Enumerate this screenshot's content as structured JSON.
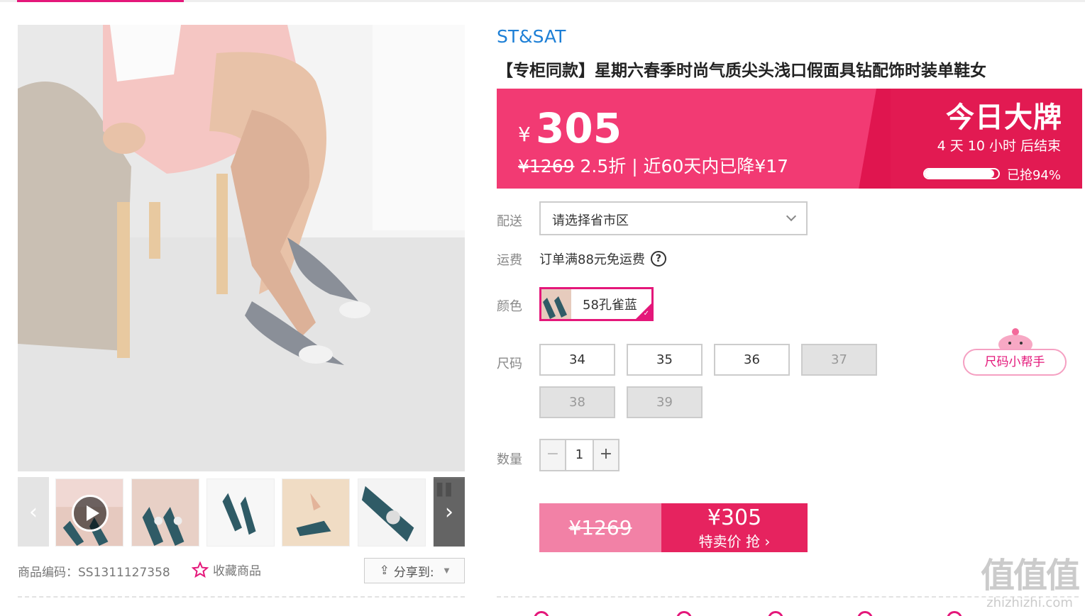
{
  "brand": "ST&SAT",
  "title": "【专柜同款】星期六春季时尚气质尖头浅口假面具钻配饰时装单鞋女",
  "promo": {
    "currency": "¥",
    "price": "305",
    "original_price": "¥1269",
    "discount_info": "2.5折 | 近60天内已降¥17",
    "badge": "今日大牌",
    "countdown": "4 天 10 小时 后结束",
    "grabbed_label": "已抢94%",
    "grabbed_fraction": 0.94
  },
  "delivery": {
    "label": "配送",
    "placeholder": "请选择省市区"
  },
  "shipping": {
    "label": "运费",
    "text": "订单满88元免运费",
    "help": "?"
  },
  "color": {
    "label": "颜色",
    "selected": "58孔雀蓝"
  },
  "size": {
    "label": "尺码",
    "options": [
      {
        "value": "34",
        "available": true
      },
      {
        "value": "35",
        "available": true
      },
      {
        "value": "36",
        "available": true
      },
      {
        "value": "37",
        "available": false
      },
      {
        "value": "38",
        "available": false
      },
      {
        "value": "39",
        "available": false
      }
    ],
    "helper": "尺码小帮手"
  },
  "quantity": {
    "label": "数量",
    "value": "1",
    "minus": "−",
    "plus": "+"
  },
  "buy": {
    "original_price": "¥1269",
    "price": "¥305",
    "label": "特卖价 抢 ›"
  },
  "meta": {
    "sku": "商品编码：SS1311127358",
    "favorite": "收藏商品",
    "share": "分享到:"
  },
  "watermark": {
    "big": "值值值",
    "small": "zhizhizhi.com"
  },
  "colors": {
    "accent": "#e4177a",
    "promo": "#f23a73",
    "brand_link": "#1d7fd6"
  }
}
